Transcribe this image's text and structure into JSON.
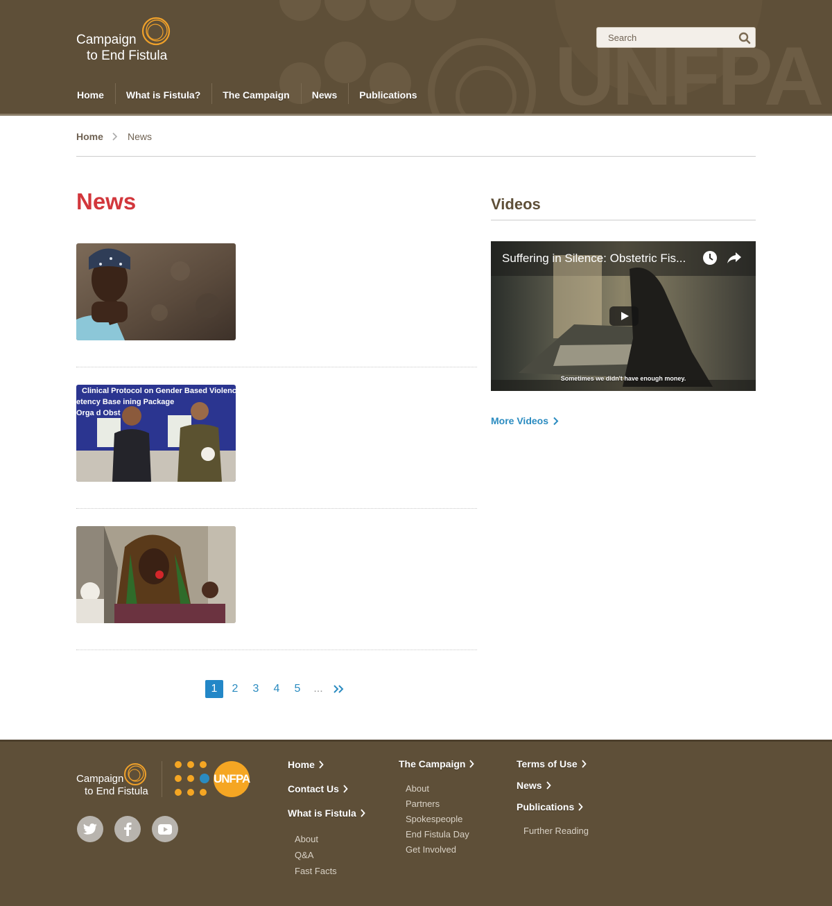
{
  "header": {
    "logo_line1": "Campaign",
    "logo_line2": "to End Fistula",
    "search_placeholder": "Search",
    "nav": [
      {
        "label": "Home"
      },
      {
        "label": "What is Fistula?"
      },
      {
        "label": "The Campaign"
      },
      {
        "label": "News"
      },
      {
        "label": "Publications"
      }
    ],
    "bg_watermark": "UNFPA"
  },
  "breadcrumb": {
    "home": "Home",
    "current": "News"
  },
  "main": {
    "title": "News",
    "items": [
      {
        "thumb": "photo-girl-by-mud-wall"
      },
      {
        "thumb": "photo-men-holding-documents"
      },
      {
        "thumb": "photo-woman-speaking-into-microphone"
      }
    ],
    "pagination": {
      "pages": [
        "1",
        "2",
        "3",
        "4",
        "5"
      ],
      "current": "1",
      "ellipsis": "..."
    }
  },
  "sidebar": {
    "videos_title": "Videos",
    "video": {
      "title": "Suffering in Silence: Obstetric Fis...",
      "caption": "Sometimes we didn't have enough money."
    },
    "more_videos": "More Videos"
  },
  "footer": {
    "logo_line1": "Campaign",
    "logo_line2": "to End Fistula",
    "unfpa_label": "UNFPA",
    "social": [
      "twitter-icon",
      "facebook-icon",
      "youtube-icon"
    ],
    "col1": {
      "home": "Home",
      "contact": "Contact Us",
      "what_is": "What is Fistula",
      "links": [
        "About",
        "Q&A",
        "Fast Facts"
      ]
    },
    "col2": {
      "campaign": "The Campaign",
      "links": [
        "About",
        "Partners",
        "Spokespeople",
        "End Fistula Day",
        "Get Involved"
      ]
    },
    "col3": {
      "terms": "Terms of Use",
      "news": "News",
      "publications": "Publications",
      "links": [
        "Further Reading"
      ]
    }
  },
  "colors": {
    "brand_brown": "#5e4f38",
    "accent_red": "#d2373c",
    "link_blue": "#2a8bc0",
    "logo_orange": "#f5a623"
  }
}
